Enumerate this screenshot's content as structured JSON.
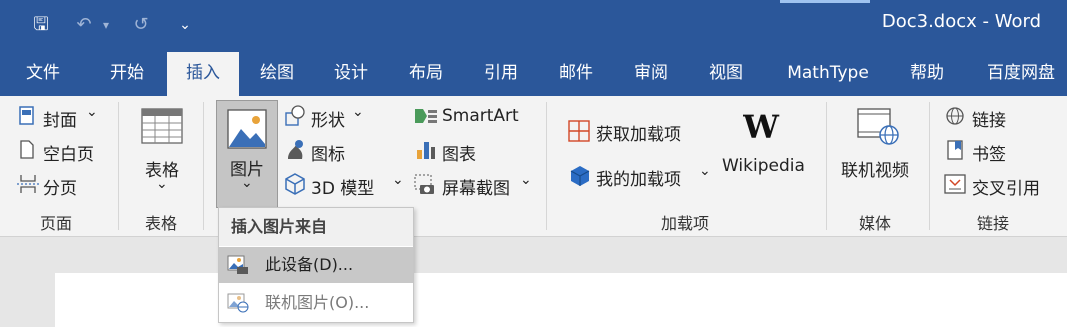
{
  "window": {
    "title": "Doc3.docx  -  Word"
  },
  "qat": {
    "save_glyph": "🖫",
    "undo_glyph": "↶",
    "dropdown_glyph": "▾",
    "redo_glyph": "↺",
    "customize_glyph": "⌄"
  },
  "tabs": [
    {
      "label": "文件"
    },
    {
      "label": "开始"
    },
    {
      "label": "插入"
    },
    {
      "label": "绘图"
    },
    {
      "label": "设计"
    },
    {
      "label": "布局"
    },
    {
      "label": "引用"
    },
    {
      "label": "邮件"
    },
    {
      "label": "审阅"
    },
    {
      "label": "视图"
    },
    {
      "label": "MathType"
    },
    {
      "label": "帮助"
    },
    {
      "label": "百度网盘"
    }
  ],
  "active_tab": "插入",
  "ribbon": {
    "pages": {
      "cover": "封面",
      "blank": "空白页",
      "break": "分页",
      "group": "页面"
    },
    "tables": {
      "table": "表格",
      "group": "表格"
    },
    "illustrations": {
      "pictures": "图片",
      "shapes": "形状",
      "icons": "图标",
      "model3d": "3D 模型",
      "smartart": "SmartArt",
      "chart": "图表",
      "screenshot": "屏幕截图"
    },
    "addins": {
      "get": "获取加载项",
      "my": "我的加载项",
      "wikipedia": "Wikipedia",
      "group": "加载项"
    },
    "media": {
      "video": "联机视频",
      "group": "媒体"
    },
    "links": {
      "link": "链接",
      "bookmark": "书签",
      "crossref": "交叉引用",
      "group": "链接"
    },
    "arrow": "⌄"
  },
  "picture_menu": {
    "header": "插入图片来自",
    "items": [
      {
        "label": "此设备(D)...",
        "state": "hover"
      },
      {
        "label": "联机图片(O)...",
        "state": "disabled"
      }
    ]
  },
  "colors": {
    "accent": "#2b579a",
    "ribbon_bg": "#f3f3f3",
    "menu_hover": "#c8c8c8"
  }
}
